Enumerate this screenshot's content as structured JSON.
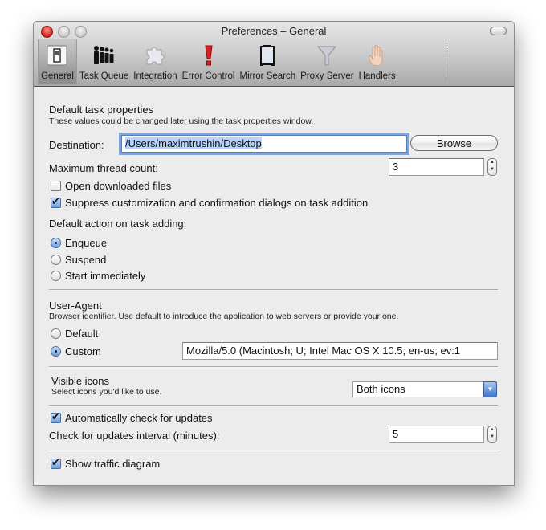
{
  "window": {
    "title": "Preferences – General"
  },
  "toolbar": {
    "items": [
      {
        "label": "General",
        "icon": "general-switch-icon",
        "selected": true
      },
      {
        "label": "Task Queue",
        "icon": "people-queue-icon",
        "selected": false
      },
      {
        "label": "Integration",
        "icon": "puzzle-piece-icon",
        "selected": false
      },
      {
        "label": "Error Control",
        "icon": "exclamation-icon",
        "selected": false
      },
      {
        "label": "Mirror Search",
        "icon": "mirror-icon",
        "selected": false
      },
      {
        "label": "Proxy Server",
        "icon": "funnel-icon",
        "selected": false
      },
      {
        "label": "Handlers",
        "icon": "hand-icon",
        "selected": false
      }
    ]
  },
  "task_props": {
    "heading": "Default task properties",
    "description": "These values could be changed later using the task properties window.",
    "destination_label": "Destination:",
    "destination_value": "/Users/maximtrushin/Desktop",
    "browse_label": "Browse",
    "thread_label": "Maximum thread count:",
    "thread_value": "3",
    "open_files_label": "Open downloaded files",
    "open_files_checked": false,
    "suppress_label": "Suppress customization and confirmation dialogs on task addition",
    "suppress_checked": true,
    "default_action_label": "Default action on task adding:",
    "actions": [
      {
        "label": "Enqueue",
        "selected": true
      },
      {
        "label": "Suspend",
        "selected": false
      },
      {
        "label": "Start immediately",
        "selected": false
      }
    ]
  },
  "user_agent": {
    "heading": "User-Agent",
    "description": "Browser identifier. Use default to introduce the application to web servers or provide your one.",
    "default_label": "Default",
    "default_selected": false,
    "custom_label": "Custom",
    "custom_selected": true,
    "custom_value": "Mozilla/5.0 (Macintosh; U; Intel Mac OS X 10.5; en-us; ev:1"
  },
  "visible_icons": {
    "heading": "Visible icons",
    "description": "Select icons you'd like to use.",
    "selected_option": "Both icons"
  },
  "updates": {
    "auto_check_label": "Automatically check for updates",
    "auto_check_checked": true,
    "interval_label": "Check for updates interval (minutes):",
    "interval_value": "5"
  },
  "traffic": {
    "label": "Show traffic diagram",
    "checked": true
  },
  "colors": {
    "window_bg": "#ececec",
    "accent_blue": "#3b78d6",
    "close_red": "#e0322a"
  }
}
